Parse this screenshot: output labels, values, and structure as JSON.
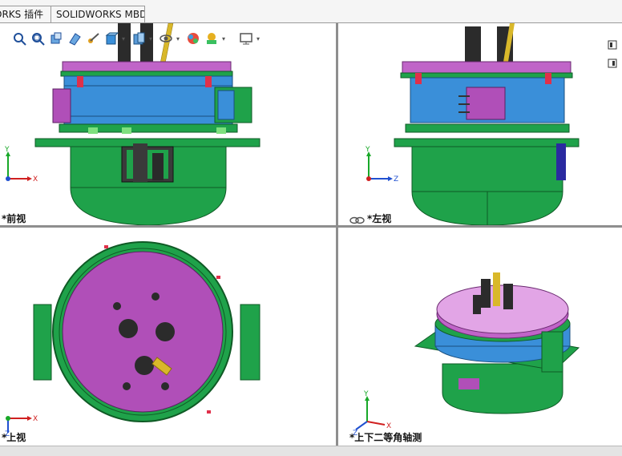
{
  "tabs": [
    {
      "label": "ORKS 插件"
    },
    {
      "label": "SOLIDWORKS MBD"
    }
  ],
  "viewports": {
    "front": {
      "label": "*前视"
    },
    "left": {
      "label": "*左视"
    },
    "top": {
      "label": "*上视"
    },
    "iso": {
      "label": "*上下二等角轴测"
    }
  },
  "triad": {
    "x": "X",
    "y": "Y",
    "z": "Z"
  },
  "hud_icons": [
    "zoom-to-fit-icon",
    "zoom-to-area-icon",
    "previous-view-icon",
    "section-view-icon",
    "dynamic-annotation-icon",
    "view-orientation-icon",
    "display-style-icon",
    "hide-show-icon",
    "edit-appearance-icon",
    "apply-scene-icon",
    "view-settings-icon"
  ],
  "colors": {
    "green": "#1fa24a",
    "dark_green": "#137a35",
    "blue": "#3a8fd9",
    "magenta": "#b04fb8",
    "pink": "#e05b9a",
    "gold": "#d9b82a",
    "dark": "#2a2a2a"
  }
}
